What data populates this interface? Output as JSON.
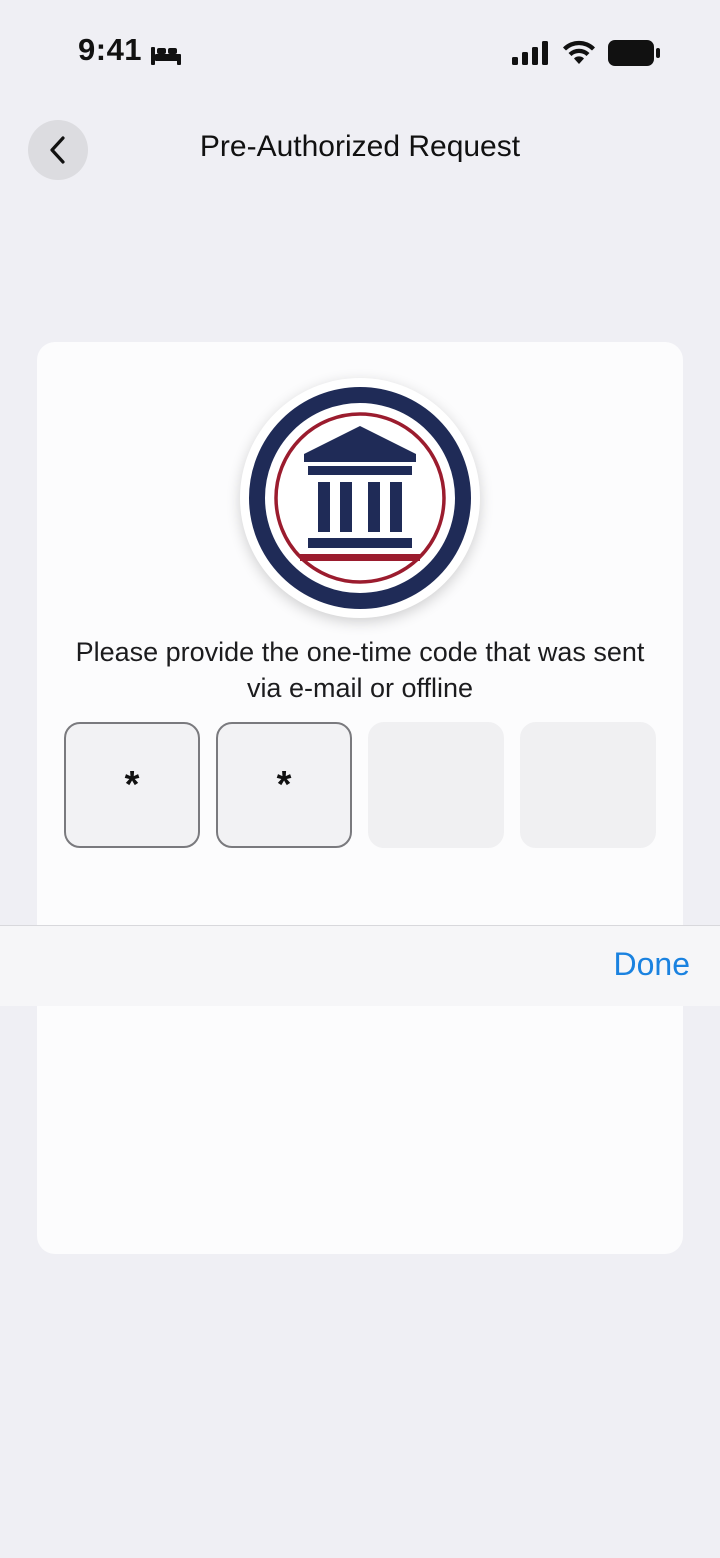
{
  "status_bar": {
    "time": "9:41"
  },
  "nav": {
    "title": "Pre-Authorized Request"
  },
  "prompt": {
    "text": "Please provide the one-time code that was sent via e-mail or offline"
  },
  "code_inputs": [
    {
      "value": "*"
    },
    {
      "value": "*"
    },
    {
      "value": ""
    },
    {
      "value": ""
    }
  ],
  "keyboard_accessory": {
    "done_label": "Done"
  },
  "colors": {
    "accent": "#1a82e0",
    "logo_navy": "#1f2b57",
    "logo_red": "#9b1c2e"
  }
}
